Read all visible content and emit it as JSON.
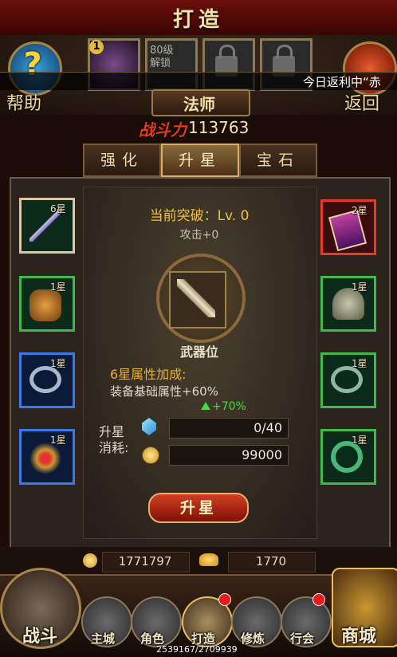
{
  "header": {
    "title": "打造",
    "help_label": "帮助",
    "back_label": "返回",
    "hero_slots": [
      {
        "badge": "1"
      },
      {
        "unlock_text": "80级\n解锁"
      },
      {
        "locked": true
      },
      {
        "locked": true
      }
    ],
    "marquee": "今日返利中“赤",
    "class_name": "法师",
    "power_label": "战斗力",
    "power_value": "113763"
  },
  "tabs": [
    {
      "label": "强化"
    },
    {
      "label": "升星",
      "active": true
    },
    {
      "label": "宝石"
    }
  ],
  "star_panel": {
    "breakthrough": "当前突破：Lv. 0",
    "attack": "攻击+0",
    "slot_label": "武器位",
    "bonus_title": "6星属性加成:",
    "bonus_desc": "装备基础属性+60%",
    "bonus_up": "+70%",
    "cost_label": "升星消耗:",
    "cost_gem": "0/40",
    "cost_gold": "99000",
    "action_label": "升星"
  },
  "equipment": {
    "left": [
      {
        "name": "法杖",
        "stars": "6星",
        "rarity_color": "#d8c8a8"
      },
      {
        "name": "护腕",
        "stars": "1星",
        "rarity_color": "#40b850"
      },
      {
        "name": "戒指",
        "stars": "1星",
        "rarity_color": "#3a7ae8"
      },
      {
        "name": "项链",
        "stars": "1星",
        "rarity_color": "#3a7ae8"
      }
    ],
    "right": [
      {
        "name": "法书",
        "stars": "2星",
        "rarity_color": "#e83a2a"
      },
      {
        "name": "头盔",
        "stars": "1星",
        "rarity_color": "#40b850"
      },
      {
        "name": "戒指",
        "stars": "1星",
        "rarity_color": "#40b850"
      },
      {
        "name": "玉环",
        "stars": "1星",
        "rarity_color": "#40b850"
      }
    ]
  },
  "resources": {
    "gold": "1771797",
    "ingot": "1770"
  },
  "nav": {
    "battle": "战斗",
    "city": "主城",
    "role": "角色",
    "forge": "打造",
    "train": "修炼",
    "guild": "行会",
    "shop": "商城"
  },
  "coords": "2539167/2709939"
}
